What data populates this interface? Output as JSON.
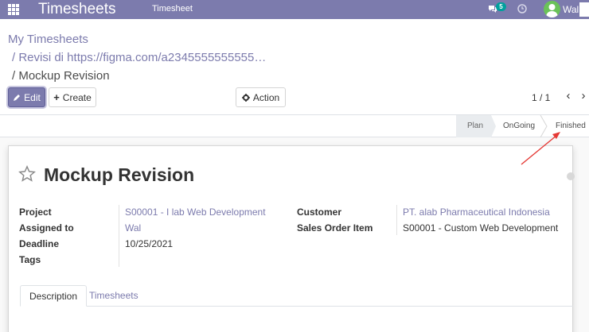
{
  "navbar": {
    "app_title": "Timesheets",
    "menu_item": "Timesheet",
    "chat_count": "5",
    "user_name": "Wal"
  },
  "breadcrumb": {
    "root": "My Timesheets",
    "parent": "/ Revisi di https://figma.com/a2345555555555…",
    "current": "/ Mockup Revision"
  },
  "toolbar": {
    "edit_label": "Edit",
    "create_label": "Create",
    "action_label": "Action"
  },
  "pager": {
    "value": "1 / 1"
  },
  "statusbar": {
    "stages": [
      "Plan",
      "OnGoing",
      "Finished"
    ],
    "active_stage": "Plan"
  },
  "record": {
    "title": "Mockup Revision",
    "fields": {
      "project_label": "Project",
      "project_value": "S00001 - I    lab Web Development",
      "assigned_label": "Assigned to",
      "assigned_value": "Wal",
      "deadline_label": "Deadline",
      "deadline_value": "10/25/2021",
      "tags_label": "Tags",
      "customer_label": "Customer",
      "customer_value": "PT.    alab Pharmaceutical Indonesia",
      "sale_order_label": "Sales Order Item",
      "sale_order_value": "S00001 - Custom Web Development"
    }
  },
  "tabs": {
    "description": "Description",
    "timesheets": "Timesheets"
  },
  "colors": {
    "brand": "#7c7bad",
    "badge": "#00a09d",
    "avatar": "#6ac259",
    "annotation": "#e53935"
  }
}
